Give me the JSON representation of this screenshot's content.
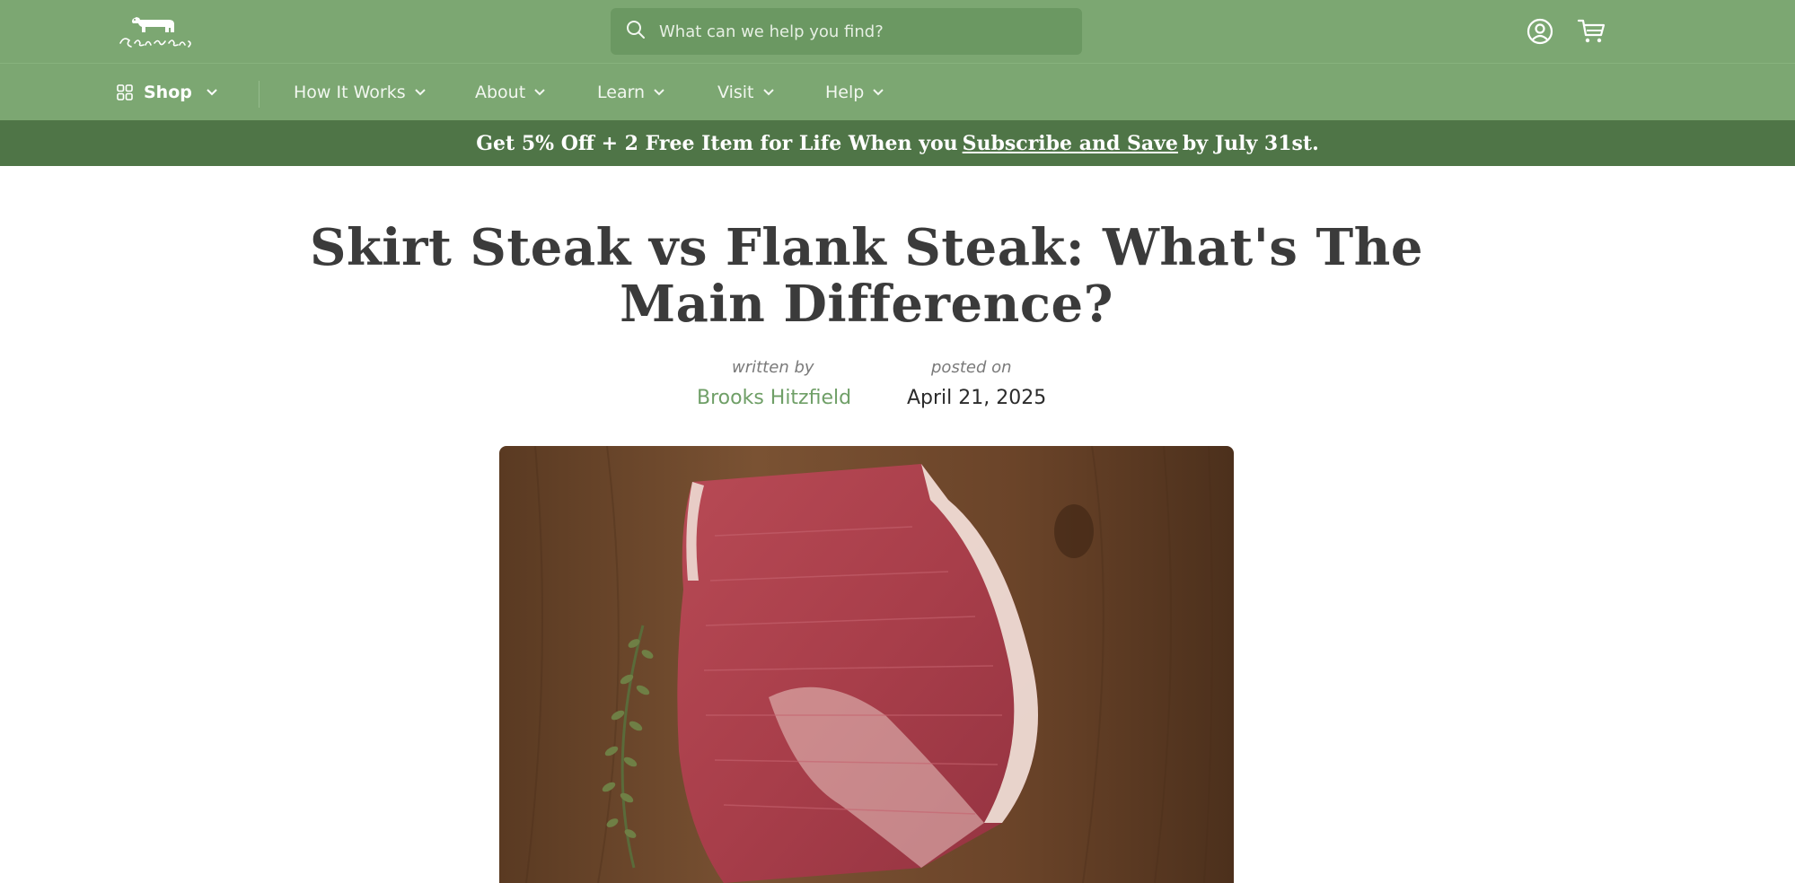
{
  "header": {
    "logo_icon": "cow-logo-icon",
    "search": {
      "placeholder": "What can we help you find?"
    },
    "account_icon": "user-circle-icon",
    "cart_icon": "shopping-cart-icon"
  },
  "nav": {
    "items": [
      {
        "label": "Shop"
      },
      {
        "label": "How It Works"
      },
      {
        "label": "About"
      },
      {
        "label": "Learn"
      },
      {
        "label": "Visit"
      },
      {
        "label": "Help"
      }
    ]
  },
  "promo": {
    "text_before": "Get 5% Off + 2 Free Item for Life When you",
    "link": "Subscribe and Save",
    "text_after": "by July 31st."
  },
  "article": {
    "title": "Skirt Steak vs Flank Steak: What's The Main Difference?",
    "written_by_label": "written by",
    "author": "Brooks Hitzfield",
    "posted_on_label": "posted on",
    "date": "April 21, 2025",
    "hero_image": "raw-flank-steak-on-wooden-board"
  },
  "colors": {
    "header_green": "#7ca772",
    "promo_green": "#4f7547",
    "author_green": "#6f9f67"
  }
}
